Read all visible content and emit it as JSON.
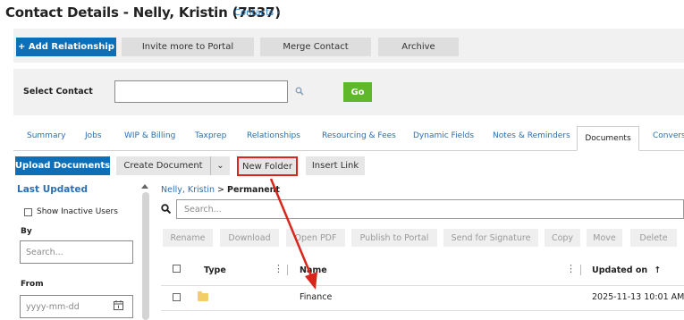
{
  "header": {
    "title": "Contact Details - Nelly, Kristin (7537)",
    "breadcrumb": "Contacts ›"
  },
  "toolbar": {
    "add_relationship": "+ Add Relationship",
    "invite_portal": "Invite more to Portal",
    "merge_contact": "Merge Contact",
    "archive": "Archive"
  },
  "select_contact": {
    "label": "Select Contact",
    "value": "",
    "go": "Go"
  },
  "tabs": [
    {
      "label": "Summary"
    },
    {
      "label": "Jobs"
    },
    {
      "label": "WIP & Billing"
    },
    {
      "label": "Taxprep"
    },
    {
      "label": "Relationships"
    },
    {
      "label": "Resourcing & Fees"
    },
    {
      "label": "Dynamic Fields"
    },
    {
      "label": "Notes & Reminders"
    },
    {
      "label": "Documents",
      "active": true
    },
    {
      "label": "Conversa"
    }
  ],
  "docs_toolbar": {
    "upload": "Upload Documents",
    "create": "Create Document",
    "create_arrow": "⌄",
    "new_folder": "New Folder",
    "insert_link": "Insert Link"
  },
  "left_panel": {
    "title": "Last Updated",
    "show_inactive": "Show Inactive Users",
    "by_label": "By",
    "by_placeholder": "Search...",
    "from_label": "From",
    "from_placeholder": "yyyy-mm-dd"
  },
  "file_panel": {
    "path_link": "Nelly, Kristin",
    "path_sep": ">",
    "path_current": "Permanent",
    "search_placeholder": "Search...",
    "actions": [
      "Rename",
      "Download",
      "Open PDF",
      "Publish to Portal",
      "Send for Signature",
      "Copy",
      "Move",
      "Delete"
    ],
    "columns": {
      "type": "Type",
      "name": "Name",
      "updated": "Updated on",
      "sort_indicator": "↑"
    },
    "rows": [
      {
        "icon": "folder-icon",
        "name": "Finance",
        "updated": "2025-11-13 10:01 AM"
      }
    ]
  },
  "colors": {
    "primary": "#0d6fb8",
    "go": "#5eb82a",
    "highlight": "#d9261c",
    "link": "#2a6fb3"
  }
}
